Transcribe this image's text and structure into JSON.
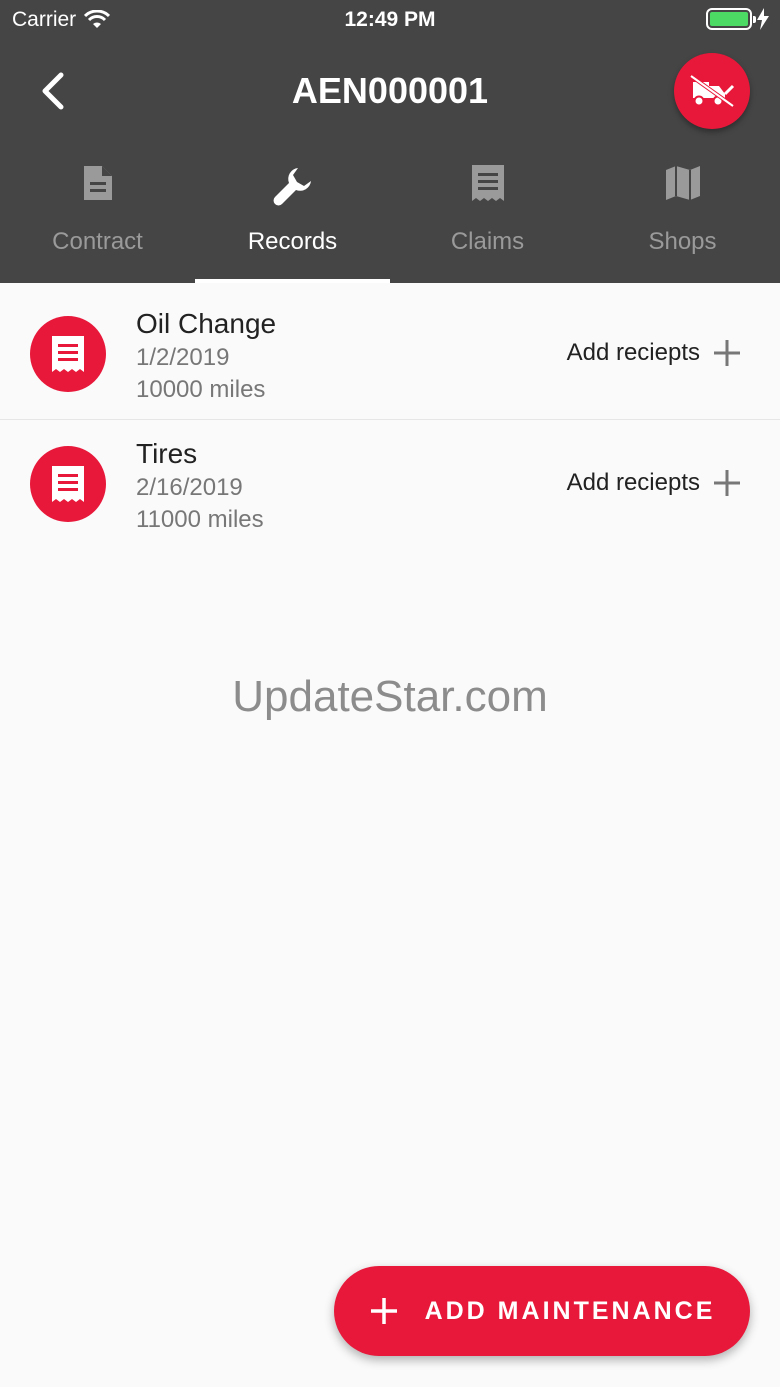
{
  "status_bar": {
    "carrier": "Carrier",
    "time": "12:49 PM",
    "wifi_icon": "wifi-icon",
    "battery_icon": "battery-icon",
    "battery_level": 1.0,
    "charging_icon": "bolt-icon"
  },
  "header": {
    "title": "AEN000001",
    "back_icon": "chevron-left-icon",
    "action_icon": "tow-truck-icon",
    "background_color": "#454545",
    "accent_color": "#e8183a"
  },
  "tabs": [
    {
      "label": "Contract",
      "icon": "document-icon",
      "active": false
    },
    {
      "label": "Records",
      "icon": "wrench-icon",
      "active": true
    },
    {
      "label": "Claims",
      "icon": "receipt-icon",
      "active": false
    },
    {
      "label": "Shops",
      "icon": "map-icon",
      "active": false
    }
  ],
  "records": [
    {
      "title": "Oil Change",
      "date": "1/2/2019",
      "mileage": "10000 miles",
      "action_label": "Add reciepts",
      "icon": "receipt-icon"
    },
    {
      "title": "Tires",
      "date": "2/16/2019",
      "mileage": "11000 miles",
      "action_label": "Add reciepts",
      "icon": "receipt-icon"
    }
  ],
  "watermark": "UpdateStar.com",
  "fab": {
    "label": "ADD MAINTENANCE",
    "icon": "plus-icon"
  }
}
